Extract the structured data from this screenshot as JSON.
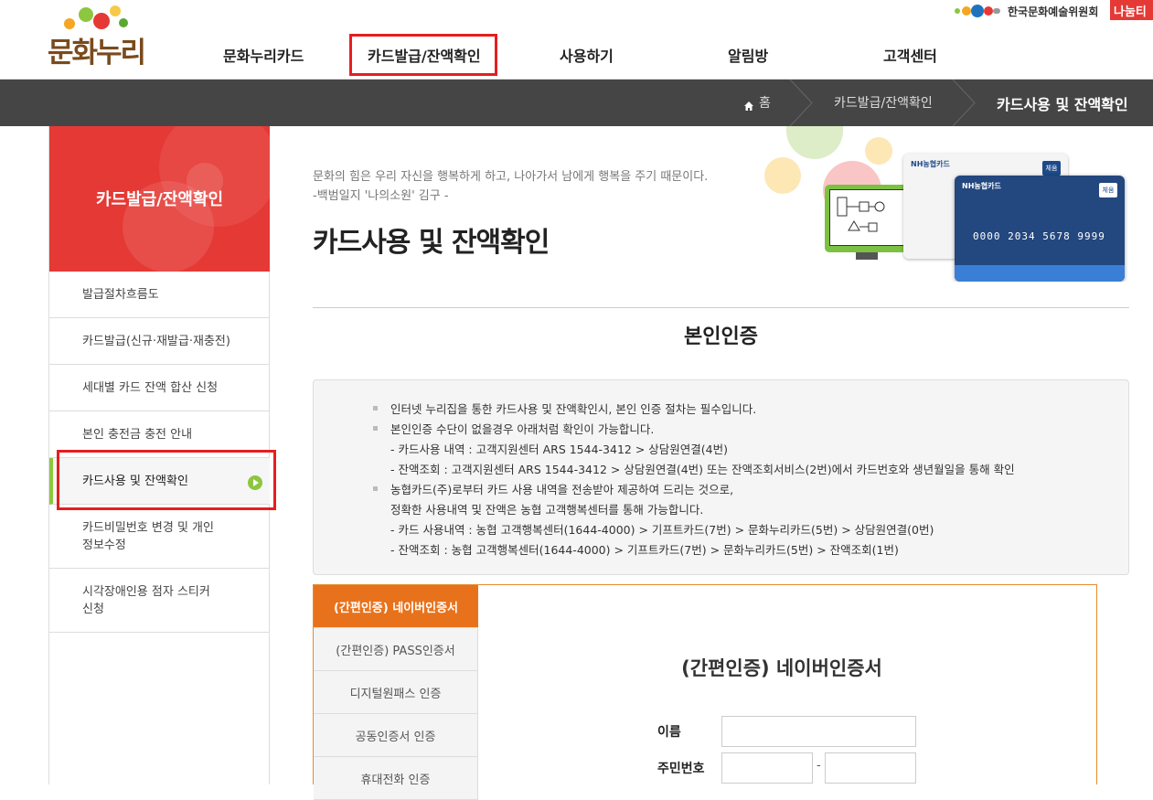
{
  "header": {
    "logo_text": "문화누리",
    "nav": [
      "문화누리카드",
      "카드발급/잔액확인",
      "사용하기",
      "알림방",
      "고객센터"
    ],
    "org_name": "한국문화예술위원회",
    "org_badge": "나눔티"
  },
  "breadcrumb": {
    "home": "홈",
    "level1": "카드발급/잔액확인",
    "current": "카드사용 및 잔액확인"
  },
  "sidebar": {
    "title": "카드발급/잔액확인",
    "items": [
      "발급절차흐름도",
      "카드발급(신규·재발급·재충전)",
      "세대별 카드 잔액 합산 신청",
      "본인 충전금 충전 안내",
      "카드사용 및 잔액확인",
      "카드비밀번호 변경 및 개인\n정보수정",
      "시각장애인용 점자 스티커\n신청"
    ]
  },
  "main": {
    "quote_line1": "문화의 힘은 우리 자신을 행복하게 하고, 나아가서 남에게 행복을 주기 때문이다.",
    "quote_line2": "-백범일지 '나의소원' 김구 -",
    "page_title": "카드사용 및 잔액확인",
    "card_front_brand": "NH농협카드",
    "card_front_number": "0000 2034 5678 9999",
    "card_back_brand": "NH농협카드",
    "card_badge": "체움",
    "section_title": "본인인증",
    "notice": [
      "인터넷 누리집을 통한 카드사용 및 잔액확인시, 본인 인증 절차는 필수입니다.",
      "본인인증 수단이 없을경우 아래처럼 확인이 가능합니다.",
      "- 카드사용 내역 : 고객지원센터 ARS 1544-3412 > 상담원연결(4번)",
      "- 잔액조회 : 고객지원센터 ARS 1544-3412 > 상담원연결(4번) 또는 잔액조회서비스(2번)에서 카드번호와 생년월일을 통해 확인",
      "농협카드(주)로부터 카드 사용 내역을 전송받아 제공하여 드리는 것으로,",
      "정확한 사용내역 및 잔액은 농협 고객행복센터를 통해 가능합니다.",
      "- 카드 사용내역 : 농협 고객행복센터(1644-4000) > 기프트카드(7번) > 문화누리카드(5번) > 상담원연결(0번)",
      "- 잔액조회 : 농협 고객행복센터(1644-4000) > 기프트카드(7번) > 문화누리카드(5번) > 잔액조회(1번)"
    ],
    "tabs": [
      "(간편인증) 네이버인증서",
      "(간편인증) PASS인증서",
      "디지털원패스 인증",
      "공동인증서 인증",
      "휴대전화 인증"
    ],
    "form_title": "(간편인증) 네이버인증서",
    "name_label": "이름",
    "rrn_label": "주민번호",
    "rrn_separator": "-"
  }
}
